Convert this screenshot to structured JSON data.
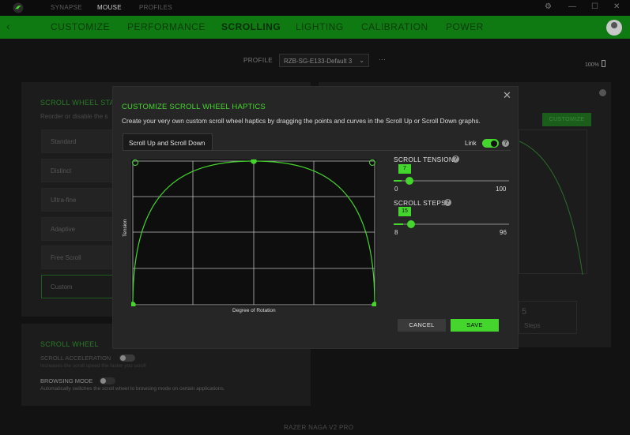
{
  "topbar": {
    "nav": [
      "SYNAPSE",
      "MOUSE",
      "PROFILES"
    ],
    "active": "MOUSE"
  },
  "tabs": [
    "CUSTOMIZE",
    "PERFORMANCE",
    "SCROLLING",
    "LIGHTING",
    "CALIBRATION",
    "POWER"
  ],
  "active_tab": "SCROLLING",
  "profile": {
    "label": "PROFILE",
    "value": "RZB-SG-E133-Default 3",
    "more": "···"
  },
  "battery": "100%",
  "background": {
    "stages_title": "SCROLL WHEEL STAGES",
    "stages_desc": "Reorder or disable the s",
    "stages": [
      "Standard",
      "Distinct",
      "Ultra-fine",
      "Adaptive",
      "Free Scroll",
      "Custom"
    ],
    "customize_btn": "CUSTOMIZE",
    "steps_value": "5",
    "steps_label": "Steps",
    "wheel_title": "SCROLL WHEEL",
    "accel_label": "SCROLL ACCELERATION",
    "accel_desc": "Increases the scroll speed the faster you scroll",
    "browsing_label": "BROWSING MODE",
    "browsing_desc": "Automatically switches the scroll wheel to browsing mode on certain applications.",
    "footer": "RAZER NAGA V2 PRO"
  },
  "modal": {
    "title": "CUSTOMIZE SCROLL WHEEL HAPTICS",
    "description": "Create your very own custom scroll wheel haptics by dragging the points and curves in the Scroll Up or Scroll Down graphs.",
    "tab": "Scroll Up and Scroll Down",
    "link_label": "Link",
    "link_on": true,
    "graph": {
      "y_label": "Tension",
      "x_label": "Degree of Rotation"
    },
    "tension": {
      "title": "SCROLL TENSION",
      "value": "7",
      "min": "0",
      "max": "100",
      "fraction": 0.07
    },
    "steps": {
      "title": "SCROLL STEPS",
      "value": "15",
      "min": "8",
      "max": "96",
      "fraction": 0.08
    },
    "cancel": "CANCEL",
    "save": "SAVE"
  },
  "colors": {
    "accent": "#44d62c",
    "tabbar": "#0f7a12"
  }
}
